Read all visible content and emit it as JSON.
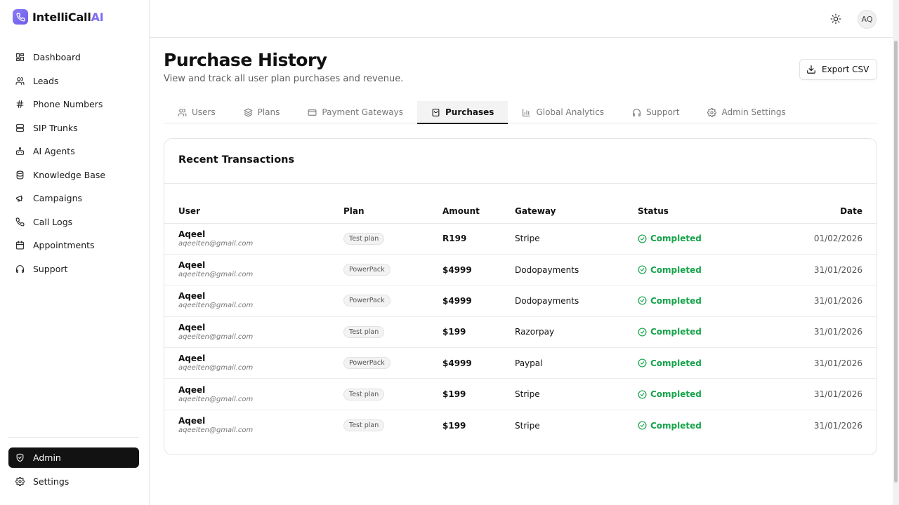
{
  "brand": {
    "name": "IntelliCall",
    "accent": "AI"
  },
  "sidebar": {
    "items": [
      {
        "label": "Dashboard",
        "icon": "grid-icon"
      },
      {
        "label": "Leads",
        "icon": "users-icon"
      },
      {
        "label": "Phone Numbers",
        "icon": "hash-icon"
      },
      {
        "label": "SIP Trunks",
        "icon": "server-icon"
      },
      {
        "label": "AI Agents",
        "icon": "bot-icon"
      },
      {
        "label": "Knowledge Base",
        "icon": "database-icon"
      },
      {
        "label": "Campaigns",
        "icon": "megaphone-icon"
      },
      {
        "label": "Call Logs",
        "icon": "phone-icon"
      },
      {
        "label": "Appointments",
        "icon": "calendar-icon"
      },
      {
        "label": "Support",
        "icon": "headphones-icon"
      }
    ],
    "admin_label": "Admin",
    "settings_label": "Settings"
  },
  "header": {
    "avatar_initials": "AQ"
  },
  "page": {
    "title": "Purchase History",
    "subtitle": "View and track all user plan purchases and revenue.",
    "export_label": "Export CSV"
  },
  "tabs": [
    {
      "label": "Users",
      "icon": "users-icon"
    },
    {
      "label": "Plans",
      "icon": "layers-icon"
    },
    {
      "label": "Payment Gateways",
      "icon": "credit-card-icon"
    },
    {
      "label": "Purchases",
      "icon": "shopping-bag-icon",
      "active": true
    },
    {
      "label": "Global Analytics",
      "icon": "bar-chart-icon"
    },
    {
      "label": "Support",
      "icon": "headphones-icon"
    },
    {
      "label": "Admin Settings",
      "icon": "gear-icon"
    }
  ],
  "table": {
    "title": "Recent Transactions",
    "columns": {
      "user": "User",
      "plan": "Plan",
      "amount": "Amount",
      "gateway": "Gateway",
      "status": "Status",
      "date": "Date"
    },
    "rows": [
      {
        "name": "Aqeel",
        "email": "aqeelten@gmail.com",
        "plan": "Test plan",
        "amount": "R199",
        "gateway": "Stripe",
        "status": "Completed",
        "date": "01/02/2026"
      },
      {
        "name": "Aqeel",
        "email": "aqeelten@gmail.com",
        "plan": "PowerPack",
        "amount": "$4999",
        "gateway": "Dodopayments",
        "status": "Completed",
        "date": "31/01/2026"
      },
      {
        "name": "Aqeel",
        "email": "aqeelten@gmail.com",
        "plan": "PowerPack",
        "amount": "$4999",
        "gateway": "Dodopayments",
        "status": "Completed",
        "date": "31/01/2026"
      },
      {
        "name": "Aqeel",
        "email": "aqeelten@gmail.com",
        "plan": "Test plan",
        "amount": "$199",
        "gateway": "Razorpay",
        "status": "Completed",
        "date": "31/01/2026"
      },
      {
        "name": "Aqeel",
        "email": "aqeelten@gmail.com",
        "plan": "PowerPack",
        "amount": "$4999",
        "gateway": "Paypal",
        "status": "Completed",
        "date": "31/01/2026"
      },
      {
        "name": "Aqeel",
        "email": "aqeelten@gmail.com",
        "plan": "Test plan",
        "amount": "$199",
        "gateway": "Stripe",
        "status": "Completed",
        "date": "31/01/2026"
      },
      {
        "name": "Aqeel",
        "email": "aqeelten@gmail.com",
        "plan": "Test plan",
        "amount": "$199",
        "gateway": "Stripe",
        "status": "Completed",
        "date": "31/01/2026"
      }
    ]
  },
  "colors": {
    "accent": "#7c6cf0",
    "success": "#16a34a",
    "active_nav": "#121212"
  }
}
